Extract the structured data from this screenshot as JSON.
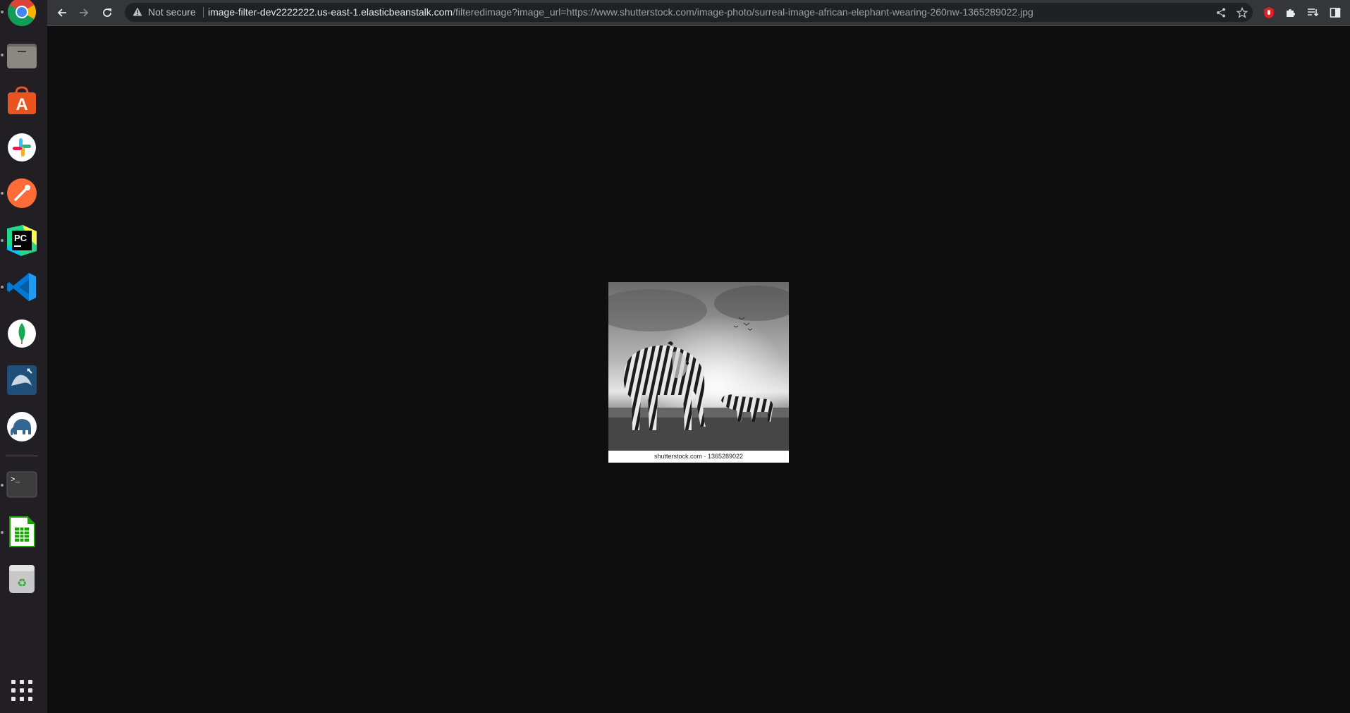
{
  "dock": {
    "apps": [
      {
        "name": "Google Chrome",
        "icon": "chrome-icon",
        "running": true
      },
      {
        "name": "Files",
        "icon": "files-icon",
        "running": true
      },
      {
        "name": "Ubuntu Software",
        "icon": "software-store-icon",
        "running": false
      },
      {
        "name": "Slack",
        "icon": "slack-icon",
        "running": false
      },
      {
        "name": "Postman",
        "icon": "postman-icon",
        "running": true
      },
      {
        "name": "PyCharm",
        "icon": "pycharm-icon",
        "running": true
      },
      {
        "name": "Visual Studio Code",
        "icon": "vscode-icon",
        "running": true
      },
      {
        "name": "MongoDB Compass",
        "icon": "mongodb-icon",
        "running": false
      },
      {
        "name": "MySQL Workbench",
        "icon": "mysql-workbench-icon",
        "running": false
      },
      {
        "name": "pgAdmin",
        "icon": "pgadmin-elephant-icon",
        "running": false
      },
      {
        "name": "Terminal",
        "icon": "terminal-icon",
        "running": true
      },
      {
        "name": "LibreOffice Calc",
        "icon": "libreoffice-calc-icon",
        "running": true
      },
      {
        "name": "Trash",
        "icon": "trash-icon",
        "running": false
      }
    ],
    "show_apps_icon": "app-grid-icon"
  },
  "browser": {
    "security_label": "Not secure",
    "url_host": "image-filter-dev2222222.us-east-1.elasticbeanstalk.com",
    "url_path": "/filteredimage?image_url=https://www.shutterstock.com/image-photo/surreal-image-african-elephant-wearing-260nw-1365289022.jpg",
    "toolbar_icons": [
      "back-icon",
      "forward-icon",
      "reload-icon",
      "share-icon",
      "bookmark-star-icon",
      "extension-red-icon",
      "extensions-puzzle-icon",
      "reading-list-icon",
      "side-panel-icon",
      "profile-avatar-icon",
      "menu-kebab-icon"
    ]
  },
  "page": {
    "image_caption": "shutterstock.com · 1365289022"
  },
  "colors": {
    "page_background": "#0e0e0e",
    "toolbar_background": "#35363a",
    "omnibox_background": "#202124",
    "dock_background": "#211e24"
  }
}
